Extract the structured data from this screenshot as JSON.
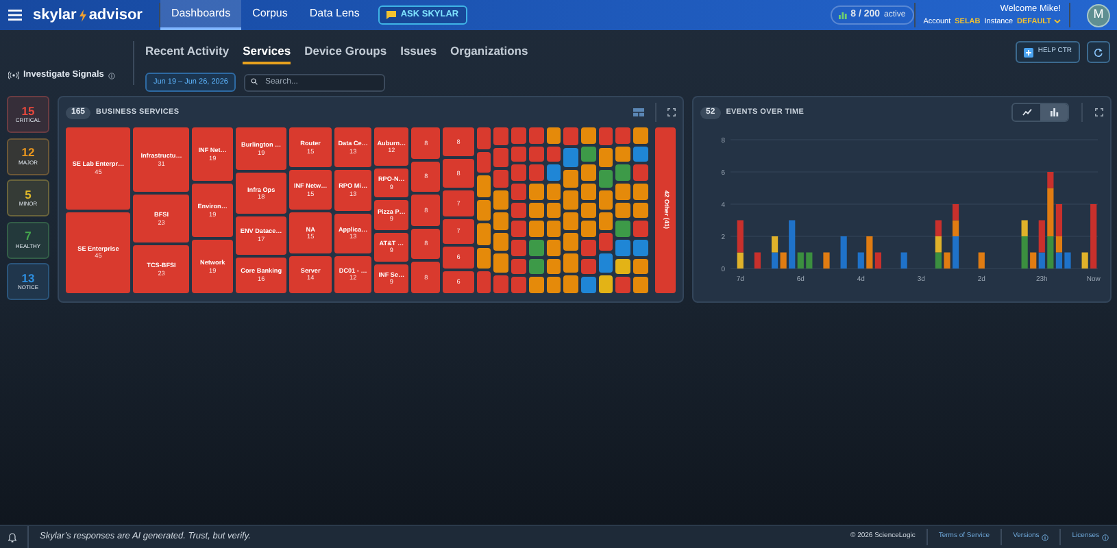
{
  "top_nav": {
    "brand_left": "skylar",
    "brand_right": "advisor",
    "tabs": [
      {
        "label": "Dashboards",
        "selected": true
      },
      {
        "label": "Corpus",
        "selected": false
      },
      {
        "label": "Data Lens",
        "selected": false
      }
    ],
    "ask_button": "ASK SKYLAR",
    "usage": "8 / 200",
    "usage_suffix": "active",
    "welcome": "Welcome Mike!",
    "account_label": "Account",
    "account": "SELAB",
    "instance_label": "Instance",
    "instance": "DEFAULT",
    "avatar": "M"
  },
  "investigate": "Investigate Signals",
  "subtabs": [
    {
      "label": "Recent Activity",
      "selected": false
    },
    {
      "label": "Services",
      "selected": true
    },
    {
      "label": "Device Groups",
      "selected": false
    },
    {
      "label": "Issues",
      "selected": false
    },
    {
      "label": "Organizations",
      "selected": false
    }
  ],
  "date_range": "Jun 19 – Jun 26, 2026",
  "search": {
    "placeholder": "Search..."
  },
  "help_button": "HELP CTR",
  "severities": [
    {
      "count": "15",
      "label": "CRITICAL",
      "color": "#e5483d"
    },
    {
      "count": "12",
      "label": "MAJOR",
      "color": "#e8961e"
    },
    {
      "count": "5",
      "label": "MINOR",
      "color": "#e0b92a"
    },
    {
      "count": "7",
      "label": "HEALTHY",
      "color": "#45a84e"
    },
    {
      "count": "13",
      "label": "NOTICE",
      "color": "#2d8fe0"
    }
  ],
  "treemap": {
    "count": "165",
    "title": "BUSINESS SERVICES",
    "columns": [
      {
        "tiles": [
          {
            "label": "SE Lab Enterpr…",
            "count": "45",
            "color": "#d93a2e"
          },
          {
            "label": "SE Enterprise",
            "count": "45",
            "color": "#d93a2e"
          }
        ]
      },
      {
        "tiles": [
          {
            "label": "Infrastructu…",
            "count": "31",
            "color": "#d93a2e"
          },
          {
            "label": "BFSI",
            "count": "23",
            "color": "#d93a2e"
          },
          {
            "label": "TCS-BFSI",
            "count": "23",
            "color": "#d93a2e"
          }
        ]
      },
      {
        "tiles": [
          {
            "label": "INF Net…",
            "count": "19",
            "color": "#d93a2e"
          },
          {
            "label": "Environ…",
            "count": "19",
            "color": "#d93a2e"
          },
          {
            "label": "Network",
            "count": "19",
            "color": "#d93a2e"
          }
        ]
      },
      {
        "tiles": [
          {
            "label": "Burlington …",
            "count": "19",
            "color": "#d93a2e"
          },
          {
            "label": "Infra Ops",
            "count": "18",
            "color": "#d93a2e"
          },
          {
            "label": "ENV Datace…",
            "count": "17",
            "color": "#d93a2e"
          },
          {
            "label": "Core Banking",
            "count": "16",
            "color": "#d93a2e"
          }
        ]
      },
      {
        "tiles": [
          {
            "label": "Router",
            "count": "15",
            "color": "#d93a2e"
          },
          {
            "label": "INF Netw…",
            "count": "15",
            "color": "#d93a2e"
          },
          {
            "label": "NA",
            "count": "15",
            "color": "#d93a2e"
          },
          {
            "label": "Server",
            "count": "14",
            "color": "#d93a2e"
          }
        ]
      },
      {
        "tiles": [
          {
            "label": "Data Ce…",
            "count": "13",
            "color": "#d93a2e"
          },
          {
            "label": "RPO Mi…",
            "count": "13",
            "color": "#d93a2e"
          },
          {
            "label": "Applica…",
            "count": "13",
            "color": "#d93a2e"
          },
          {
            "label": "DC01 - …",
            "count": "12",
            "color": "#d93a2e"
          }
        ]
      },
      {
        "tiles": [
          {
            "label": "Auburn…",
            "count": "12",
            "color": "#d93a2e"
          },
          {
            "label": "RPO-N…",
            "count": "9",
            "color": "#d93a2e"
          },
          {
            "label": "Pizza P…",
            "count": "9",
            "color": "#d93a2e"
          },
          {
            "label": "AT&T …",
            "count": "9",
            "color": "#d93a2e"
          },
          {
            "label": "INF Se…",
            "count": "9",
            "color": "#d93a2e"
          }
        ]
      },
      {
        "tiles": [
          {
            "count": "8",
            "color": "#d93a2e"
          },
          {
            "count": "8",
            "color": "#d93a2e"
          },
          {
            "count": "8",
            "color": "#d93a2e"
          },
          {
            "count": "8",
            "color": "#d93a2e"
          },
          {
            "count": "8",
            "color": "#d93a2e"
          }
        ]
      },
      {
        "tiles": [
          {
            "count": "8",
            "color": "#d93a2e"
          },
          {
            "count": "8",
            "color": "#d93a2e"
          },
          {
            "count": "7",
            "color": "#d93a2e"
          },
          {
            "count": "7",
            "color": "#d93a2e"
          },
          {
            "count": "6",
            "color": "#d93a2e"
          },
          {
            "count": "6",
            "color": "#d93a2e"
          }
        ]
      }
    ],
    "small_columns": [
      {
        "tiles": [
          {
            "color": "#d93a2e"
          },
          {
            "color": "#d93a2e"
          },
          {
            "color": "#e58a0a"
          },
          {
            "color": "#e58a0a"
          },
          {
            "color": "#e58a0a"
          },
          {
            "color": "#e58a0a"
          },
          {
            "color": "#d93a2e"
          }
        ]
      },
      {
        "tiles": [
          {
            "color": "#d93a2e"
          },
          {
            "color": "#d93a2e"
          },
          {
            "color": "#d93a2e"
          },
          {
            "color": "#e58a0a"
          },
          {
            "color": "#e58a0a"
          },
          {
            "color": "#e58a0a"
          },
          {
            "color": "#e58a0a"
          },
          {
            "color": "#d93a2e"
          }
        ]
      },
      {
        "tiles": [
          {
            "color": "#d93a2e"
          },
          {
            "color": "#d93a2e"
          },
          {
            "color": "#d93a2e"
          },
          {
            "color": "#d93a2e"
          },
          {
            "color": "#d93a2e"
          },
          {
            "color": "#d93a2e"
          },
          {
            "color": "#d93a2e"
          },
          {
            "color": "#d93a2e"
          },
          {
            "color": "#d93a2e"
          }
        ]
      },
      {
        "tiles": [
          {
            "color": "#d93a2e"
          },
          {
            "color": "#d93a2e"
          },
          {
            "color": "#d93a2e"
          },
          {
            "color": "#e58a0a"
          },
          {
            "color": "#e58a0a"
          },
          {
            "color": "#e58a0a"
          },
          {
            "color": "#3d9a48"
          },
          {
            "color": "#3d9a48"
          },
          {
            "color": "#e58a0a"
          }
        ]
      },
      {
        "tiles": [
          {
            "color": "#e58a0a"
          },
          {
            "color": "#d93a2e"
          },
          {
            "color": "#1f86d6"
          },
          {
            "color": "#e58a0a"
          },
          {
            "color": "#e58a0a"
          },
          {
            "color": "#e58a0a"
          },
          {
            "color": "#e58a0a"
          },
          {
            "color": "#e58a0a"
          },
          {
            "color": "#e58a0a"
          }
        ]
      },
      {
        "tiles": [
          {
            "color": "#d93a2e"
          },
          {
            "color": "#1f86d6"
          },
          {
            "color": "#e58a0a"
          },
          {
            "color": "#e58a0a"
          },
          {
            "color": "#e58a0a"
          },
          {
            "color": "#e58a0a"
          },
          {
            "color": "#e58a0a"
          },
          {
            "color": "#e58a0a"
          }
        ]
      },
      {
        "tiles": [
          {
            "color": "#e58a0a"
          },
          {
            "color": "#3d9a48"
          },
          {
            "color": "#e58a0a"
          },
          {
            "color": "#e58a0a"
          },
          {
            "color": "#e58a0a"
          },
          {
            "color": "#e58a0a"
          },
          {
            "color": "#d93a2e"
          },
          {
            "color": "#d93a2e"
          },
          {
            "color": "#1f86d6"
          }
        ]
      },
      {
        "tiles": [
          {
            "color": "#d93a2e"
          },
          {
            "color": "#e58a0a"
          },
          {
            "color": "#3d9a48"
          },
          {
            "color": "#e58a0a"
          },
          {
            "color": "#e58a0a"
          },
          {
            "color": "#d93a2e"
          },
          {
            "color": "#1f86d6"
          },
          {
            "color": "#e3b316"
          }
        ]
      },
      {
        "tiles": [
          {
            "color": "#d93a2e"
          },
          {
            "color": "#e58a0a"
          },
          {
            "color": "#3d9a48"
          },
          {
            "color": "#e58a0a"
          },
          {
            "color": "#e58a0a"
          },
          {
            "color": "#3d9a48"
          },
          {
            "color": "#1f86d6"
          },
          {
            "color": "#e3b316"
          },
          {
            "color": "#d93a2e"
          }
        ]
      },
      {
        "tiles": [
          {
            "color": "#e58a0a"
          },
          {
            "color": "#1f86d6"
          },
          {
            "color": "#d93a2e"
          },
          {
            "color": "#e58a0a"
          },
          {
            "color": "#e58a0a"
          },
          {
            "color": "#d93a2e"
          },
          {
            "color": "#1f86d6"
          },
          {
            "color": "#e58a0a"
          },
          {
            "color": "#e58a0a"
          }
        ]
      }
    ],
    "other": {
      "label": "42 Other (41)",
      "color": "#d93a2e"
    }
  },
  "events": {
    "count": "52",
    "title": "EVENTS OVER TIME",
    "views": [
      {
        "kind": "line",
        "selected": false
      },
      {
        "kind": "bar",
        "selected": true
      }
    ],
    "chart_data": {
      "type": "bar",
      "stacked": true,
      "categories": [
        "7d",
        null,
        null,
        null,
        null,
        null,
        null,
        "6d",
        null,
        null,
        null,
        null,
        null,
        null,
        "4d",
        null,
        null,
        null,
        null,
        null,
        null,
        "3d",
        null,
        null,
        null,
        null,
        null,
        null,
        "2d",
        null,
        null,
        null,
        null,
        null,
        null,
        "23h",
        null,
        null,
        null,
        null,
        null,
        "Now"
      ],
      "series": [
        {
          "color": "#3b8f3f",
          "values": [
            0,
            0,
            0,
            0,
            0,
            0,
            0,
            1,
            1,
            0,
            0,
            0,
            0,
            0,
            0,
            0,
            0,
            0,
            0,
            0,
            0,
            0,
            0,
            1,
            0,
            0,
            0,
            0,
            0,
            0,
            0,
            0,
            0,
            2,
            0,
            0,
            2,
            0,
            0,
            0,
            0,
            0
          ]
        },
        {
          "color": "#1f72c9",
          "values": [
            0,
            0,
            0,
            0,
            1,
            0,
            3,
            0,
            0,
            0,
            0,
            0,
            2,
            0,
            1,
            0,
            0,
            0,
            0,
            1,
            0,
            0,
            0,
            0,
            0,
            2,
            0,
            0,
            0,
            0,
            0,
            0,
            0,
            0,
            0,
            1,
            0,
            1,
            1,
            0,
            0,
            0
          ]
        },
        {
          "color": "#e0b22a",
          "values": [
            1,
            0,
            0,
            0,
            1,
            0,
            0,
            0,
            0,
            0,
            0,
            0,
            0,
            0,
            0,
            0,
            0,
            0,
            0,
            0,
            0,
            0,
            0,
            1,
            0,
            0,
            0,
            0,
            0,
            0,
            0,
            0,
            0,
            1,
            0,
            0,
            0,
            0,
            0,
            0,
            1,
            0
          ]
        },
        {
          "color": "#e07c12",
          "values": [
            0,
            0,
            0,
            0,
            0,
            1,
            0,
            0,
            0,
            0,
            1,
            0,
            0,
            0,
            0,
            2,
            0,
            0,
            0,
            0,
            0,
            0,
            0,
            0,
            1,
            1,
            0,
            0,
            1,
            0,
            0,
            0,
            0,
            0,
            1,
            0,
            3,
            1,
            0,
            0,
            0,
            0
          ]
        },
        {
          "color": "#c9302c",
          "values": [
            2,
            0,
            1,
            0,
            0,
            0,
            0,
            0,
            0,
            0,
            0,
            0,
            0,
            0,
            0,
            0,
            1,
            0,
            0,
            0,
            0,
            0,
            0,
            1,
            0,
            1,
            0,
            0,
            0,
            0,
            0,
            0,
            0,
            0,
            0,
            2,
            1,
            2,
            0,
            0,
            0,
            4
          ]
        }
      ],
      "ylim": [
        0,
        8
      ],
      "yticks": [
        0,
        2,
        4,
        6,
        8
      ],
      "grid": true
    }
  },
  "footer": {
    "disclaimer": "Skylar’s responses are AI generated. Trust, but verify.",
    "copyright": "© 2026 ScienceLogic",
    "links": [
      {
        "label": "Terms of Service",
        "info": false
      },
      {
        "label": "Versions",
        "info": true
      },
      {
        "label": "Licenses",
        "info": true
      }
    ]
  }
}
